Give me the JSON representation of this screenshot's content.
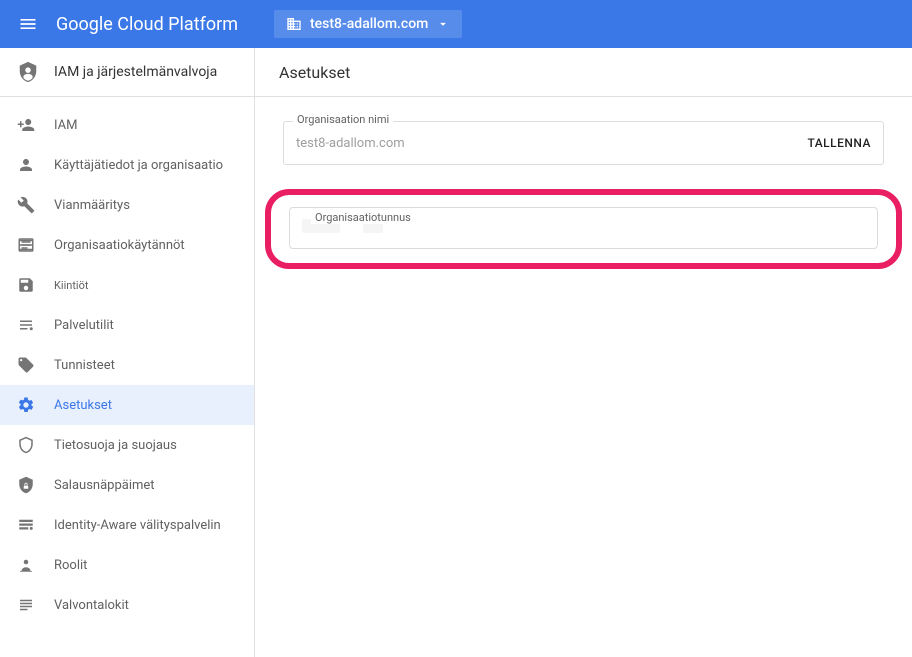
{
  "header": {
    "brand": "Google Cloud Platform",
    "project": "test8-adallom.com"
  },
  "sidebar": {
    "title": "IAM ja järjestelmänvalvoja",
    "items": [
      {
        "id": "iam",
        "label": "IAM",
        "icon": "person-plus-icon",
        "active": false
      },
      {
        "id": "identity",
        "label": "Käyttäjätiedot ja organisaatio",
        "icon": "person-icon",
        "active": false
      },
      {
        "id": "troubleshoot",
        "label": "Vianmääritys",
        "icon": "wrench-icon",
        "active": false
      },
      {
        "id": "org-policies",
        "label": "Organisaatiokäytännöt",
        "icon": "list-icon",
        "active": false
      },
      {
        "id": "quotas",
        "label": "Kiintiöt",
        "icon": "save-icon",
        "active": false,
        "small": true
      },
      {
        "id": "service-accounts",
        "label": "Palvelutilit",
        "icon": "accounts-icon",
        "active": false
      },
      {
        "id": "labels",
        "label": "Tunnisteet",
        "icon": "tag-icon",
        "active": false
      },
      {
        "id": "settings",
        "label": "Asetukset",
        "icon": "gear-icon",
        "active": true
      },
      {
        "id": "privacy",
        "label": "Tietosuoja ja suojaus",
        "icon": "shield-outline-icon",
        "active": false
      },
      {
        "id": "encryption",
        "label": "Salausnäppäimet",
        "icon": "shield-lock-icon",
        "active": false
      },
      {
        "id": "iap",
        "label": "Identity-Aware välityspalvelin",
        "icon": "iap-icon",
        "active": false
      },
      {
        "id": "roles",
        "label": "Roolit",
        "icon": "roles-icon",
        "active": false
      },
      {
        "id": "audit",
        "label": "Valvontalokit",
        "icon": "audit-icon",
        "active": false
      }
    ]
  },
  "main": {
    "title": "Asetukset",
    "org_name": {
      "label": "Organisaation nimi",
      "value": "test8-adallom.com",
      "action": "TALLENNA"
    },
    "org_id": {
      "label": "Organisaatiotunnus"
    }
  }
}
